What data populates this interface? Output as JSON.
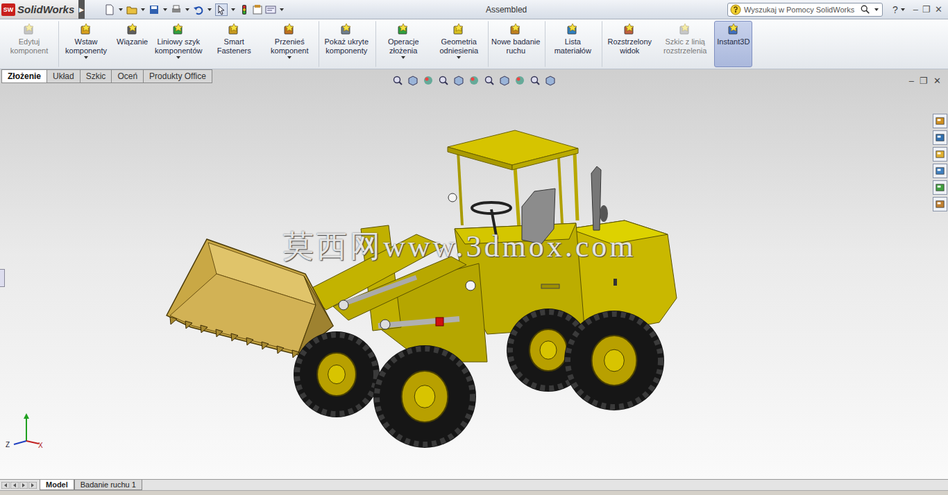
{
  "app": {
    "logo_badge": "SW",
    "logo": "SolidWorks",
    "menu_arrow": "▶"
  },
  "window": {
    "title": "Assembled",
    "controls": [
      "–",
      "❐",
      "✕"
    ]
  },
  "search": {
    "placeholder": "Wyszukaj w Pomocy SolidWorks"
  },
  "help": "?",
  "ribbon": [
    {
      "label": "Edytuj komponent",
      "disabled": true,
      "selected": false,
      "dropdown": false,
      "separator": false
    },
    {
      "label": "Wstaw komponenty",
      "disabled": false,
      "selected": false,
      "dropdown": true,
      "separator": true
    },
    {
      "label": "Wiązanie",
      "disabled": false,
      "selected": false,
      "dropdown": false,
      "separator": false
    },
    {
      "label": "Liniowy szyk komponentów",
      "disabled": false,
      "selected": false,
      "dropdown": true,
      "separator": false
    },
    {
      "label": "Smart Fasteners",
      "disabled": false,
      "selected": false,
      "dropdown": false,
      "separator": false
    },
    {
      "label": "Przenieś komponent",
      "disabled": false,
      "selected": false,
      "dropdown": true,
      "separator": false
    },
    {
      "label": "Pokaż ukryte komponenty",
      "disabled": false,
      "selected": false,
      "dropdown": false,
      "separator": true
    },
    {
      "label": "Operacje złożenia",
      "disabled": false,
      "selected": false,
      "dropdown": true,
      "separator": true
    },
    {
      "label": "Geometria odniesienia",
      "disabled": false,
      "selected": false,
      "dropdown": true,
      "separator": false
    },
    {
      "label": "Nowe badanie ruchu",
      "disabled": false,
      "selected": false,
      "dropdown": false,
      "separator": true
    },
    {
      "label": "Lista materiałów",
      "disabled": false,
      "selected": false,
      "dropdown": false,
      "separator": true
    },
    {
      "label": "Rozstrzelony widok",
      "disabled": false,
      "selected": false,
      "dropdown": false,
      "separator": true
    },
    {
      "label": "Szkic z linią rozstrzelenia",
      "disabled": true,
      "selected": false,
      "dropdown": false,
      "separator": false
    },
    {
      "label": "Instant3D",
      "disabled": false,
      "selected": true,
      "dropdown": false,
      "separator": true
    }
  ],
  "tabs": [
    {
      "label": "Złożenie",
      "selected": true
    },
    {
      "label": "Układ",
      "selected": false
    },
    {
      "label": "Szkic",
      "selected": false
    },
    {
      "label": "Oceń",
      "selected": false
    },
    {
      "label": "Produkty Office",
      "selected": false
    }
  ],
  "document_controls": [
    "–",
    "❐",
    "✕"
  ],
  "watermark": "莫西网www.3dmox.com",
  "triad": {
    "z": "Z",
    "x": "X"
  },
  "bottom_tabs": [
    {
      "label": "Model",
      "selected": true
    },
    {
      "label": "Badanie ruchu 1",
      "selected": false
    }
  ]
}
